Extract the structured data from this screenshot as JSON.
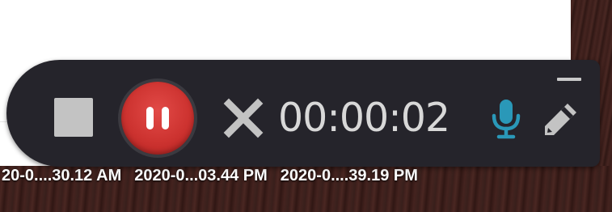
{
  "recorder": {
    "timer": "00:00:02",
    "controls": {
      "stop_icon": "stop-icon",
      "pause_icon": "pause-icon",
      "close_icon": "close-icon",
      "mic_icon": "microphone-icon",
      "pen_icon": "pencil-icon",
      "minimize_icon": "minimize-icon"
    },
    "colors": {
      "bar_background": "#25242b",
      "pause_red": "#cd3330",
      "mic_accent": "#2a98b8",
      "icon_gray": "#c3c3c3"
    }
  },
  "desktop": {
    "file_labels": [
      "20-0....30.12 AM",
      "2020-0...03.44 PM",
      "2020-0....39.19 PM"
    ]
  }
}
